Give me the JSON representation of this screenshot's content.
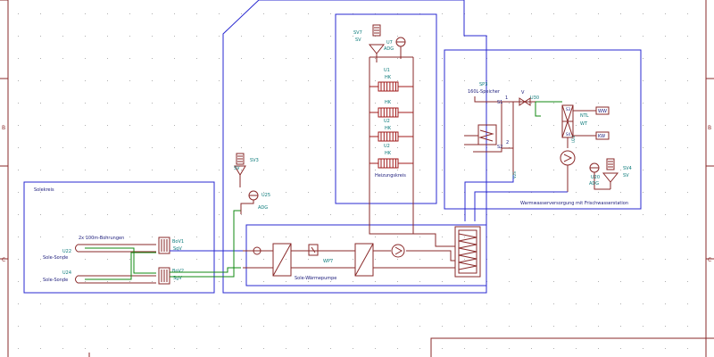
{
  "colors": {
    "frame": "#8a2a2a",
    "block_border": "#2a2ad0",
    "wire": "#118a11",
    "pipe": "#a01a1a",
    "label_teal": "#0a7a7a",
    "label_dark": "#1a1a7a",
    "grid_dot": "#b0b0b0"
  },
  "frame": {
    "row_labels": [
      "B",
      "C"
    ]
  },
  "solar": {
    "block_title": "Solekreis",
    "boreholes_label": "2x 100m-Bohrungen",
    "probe1_id": "U22",
    "probe1_name": "Sole-Sonde",
    "probe2_id": "U24",
    "probe2_name": "Sole-Sonde",
    "valve1_id": "BoV1",
    "valve1_type": "SgV",
    "valve2_id": "BoV2",
    "valve2_type": "SgV"
  },
  "expansion": {
    "valve_id": "SV3",
    "valve_type": "SV",
    "vessel_id": "U25",
    "vessel_type": "ADG"
  },
  "heating": {
    "valve_id": "SV7",
    "valve_type": "SV",
    "vessel_id": "U7",
    "vessel_type": "ADG",
    "radiators": [
      {
        "id": "U1",
        "type": "HK"
      },
      {
        "id": "",
        "type": "HK"
      },
      {
        "id": "U2",
        "type": "HK"
      },
      {
        "id": "U2",
        "type": "HK"
      }
    ],
    "block_title": "Heizungskreis"
  },
  "dhw": {
    "tank_id": "SP3",
    "tank_name": "160L-Speicher",
    "port_s1": "S1",
    "port_s2": "S2",
    "port_s3": "S3",
    "port_1": "1",
    "port_2": "2",
    "check_valve_label": "V",
    "check_valve_id": "U30",
    "station_id": "NTL",
    "station_type": "WT",
    "station_port_a": "S3",
    "station_port_b": "S4",
    "pump_label": "U22",
    "valve_id": "SV4",
    "valve_type": "SV",
    "vessel_id": "U20",
    "vessel_type": "ADG",
    "inlet_label": "KW",
    "outlet_label": "WW",
    "block_title": "Warmwasserversorgung mit Frischwasserstation",
    "label_v2": "V2S"
  },
  "heatpump": {
    "label": "Sole-Wärmepumpe",
    "id": "WP7"
  }
}
